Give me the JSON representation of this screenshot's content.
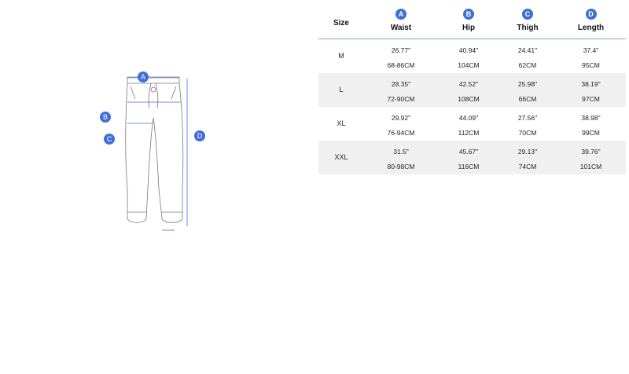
{
  "diagram": {
    "markers": [
      "A",
      "B",
      "C",
      "D"
    ],
    "accent_color": "#3f6fd6"
  },
  "table": {
    "size_header": "Size",
    "columns": [
      {
        "marker": "A",
        "label": "Waist"
      },
      {
        "marker": "B",
        "label": "Hip"
      },
      {
        "marker": "C",
        "label": "Thigh"
      },
      {
        "marker": "D",
        "label": "Length"
      }
    ],
    "rows": [
      {
        "size": "M",
        "cells": [
          {
            "in": "26.77\"",
            "cm": "68-86CM"
          },
          {
            "in": "40.94\"",
            "cm": "104CM"
          },
          {
            "in": "24.41\"",
            "cm": "62CM"
          },
          {
            "in": "37.4\"",
            "cm": "95CM"
          }
        ]
      },
      {
        "size": "L",
        "cells": [
          {
            "in": "28.35\"",
            "cm": "72-90CM"
          },
          {
            "in": "42.52\"",
            "cm": "108CM"
          },
          {
            "in": "25.98\"",
            "cm": "66CM"
          },
          {
            "in": "38.19\"",
            "cm": "97CM"
          }
        ]
      },
      {
        "size": "XL",
        "cells": [
          {
            "in": "29.92\"",
            "cm": "76-94CM"
          },
          {
            "in": "44.09\"",
            "cm": "112CM"
          },
          {
            "in": "27.56\"",
            "cm": "70CM"
          },
          {
            "in": "38.98\"",
            "cm": "99CM"
          }
        ]
      },
      {
        "size": "XXL",
        "cells": [
          {
            "in": "31.5\"",
            "cm": "80-98CM"
          },
          {
            "in": "45.67\"",
            "cm": "116CM"
          },
          {
            "in": "29.13\"",
            "cm": "74CM"
          },
          {
            "in": "39.76\"",
            "cm": "101CM"
          }
        ]
      }
    ]
  }
}
